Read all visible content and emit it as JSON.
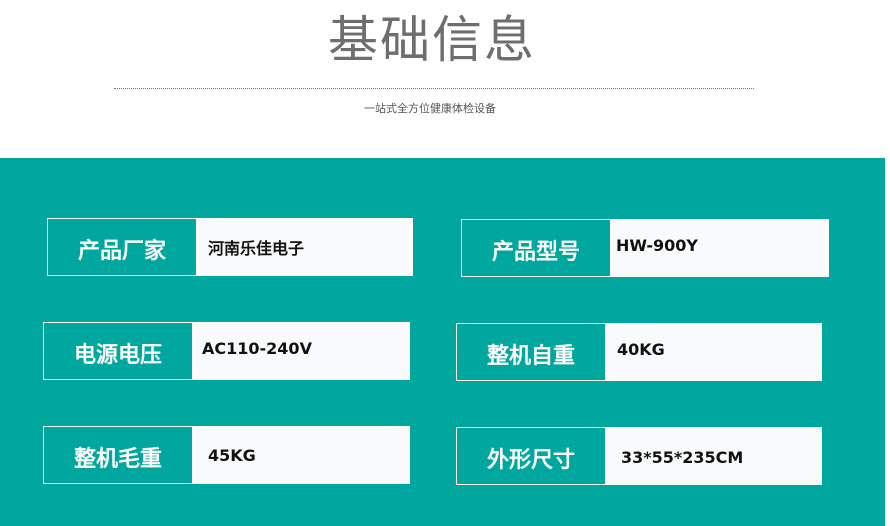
{
  "header": {
    "title": "基础信息",
    "subtitle": "一站式全方位健康体检设备"
  },
  "fields": [
    {
      "label": "产品厂家",
      "value": "河南乐佳电子"
    },
    {
      "label": "产品型号",
      "value": "HW-900Y"
    },
    {
      "label": "电源电压",
      "value": "AC110-240V"
    },
    {
      "label": "整机自重",
      "value": "40KG"
    },
    {
      "label": "整机毛重",
      "value": "45KG"
    },
    {
      "label": "外形尺寸",
      "value": "33*55*235CM"
    }
  ],
  "colors": {
    "panel": "#00a79e",
    "value_background": "#f9fafb",
    "title_text": "#6e6e6e"
  }
}
